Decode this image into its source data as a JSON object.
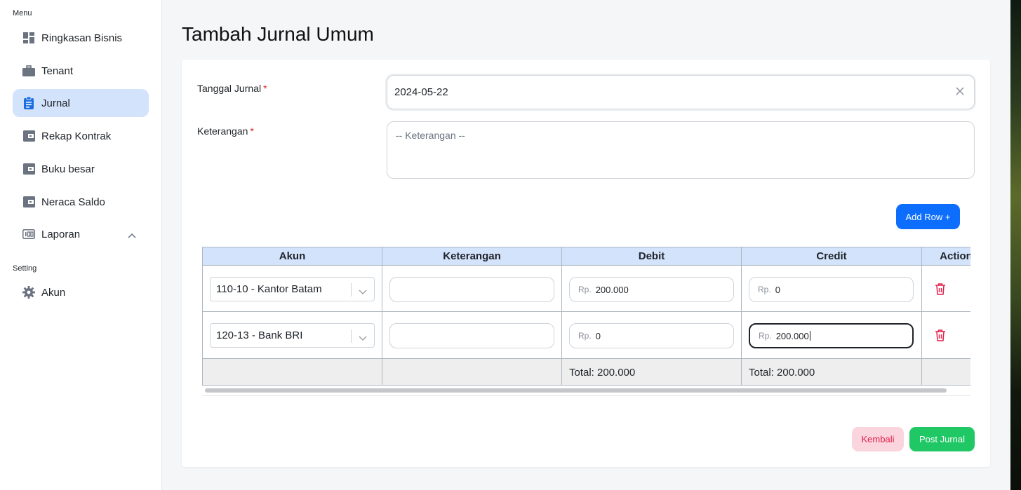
{
  "sidebar": {
    "menu_label": "Menu",
    "setting_label": "Setting",
    "items": [
      {
        "label": "Ringkasan Bisnis",
        "icon": "dashboard-icon"
      },
      {
        "label": "Tenant",
        "icon": "briefcase-icon"
      },
      {
        "label": "Jurnal",
        "icon": "clipboard-icon"
      },
      {
        "label": "Rekap Kontrak",
        "icon": "wallet-icon"
      },
      {
        "label": "Buku besar",
        "icon": "wallet-icon"
      },
      {
        "label": "Neraca Saldo",
        "icon": "wallet-icon"
      },
      {
        "label": "Laporan",
        "icon": "report-icon"
      }
    ],
    "setting_items": [
      {
        "label": "Akun",
        "icon": "gear-icon"
      }
    ],
    "active": "Jurnal",
    "accent_color": "#d3e3fc"
  },
  "page": {
    "title": "Tambah Jurnal Umum"
  },
  "form": {
    "date_label": "Tanggal Jurnal",
    "date_value": "2024-05-22",
    "desc_label": "Keterangan",
    "desc_placeholder": "-- Keterangan --",
    "required_mark": "*"
  },
  "table": {
    "add_row_label": "Add Row +",
    "headers": [
      "Akun",
      "Keterangan",
      "Debit",
      "Credit",
      "Action"
    ],
    "rows": [
      {
        "akun": "110-10 - Kantor Batam",
        "keterangan": "",
        "debit_prefix": "Rp.",
        "debit": "200.000",
        "credit_prefix": "Rp.",
        "credit": "0"
      },
      {
        "akun": "120-13 - Bank BRI",
        "keterangan": "",
        "debit_prefix": "Rp.",
        "debit": "0",
        "credit_prefix": "Rp.",
        "credit": "200.000"
      }
    ],
    "total_debit": "Total: 200.000",
    "total_credit": "Total: 200.000",
    "header_color": "#d3e3fc"
  },
  "actions": {
    "back_label": "Kembali",
    "post_label": "Post Jurnal",
    "back_color": "#fbd5de",
    "post_color": "#1fc865",
    "primary_color": "#0d6efd"
  }
}
